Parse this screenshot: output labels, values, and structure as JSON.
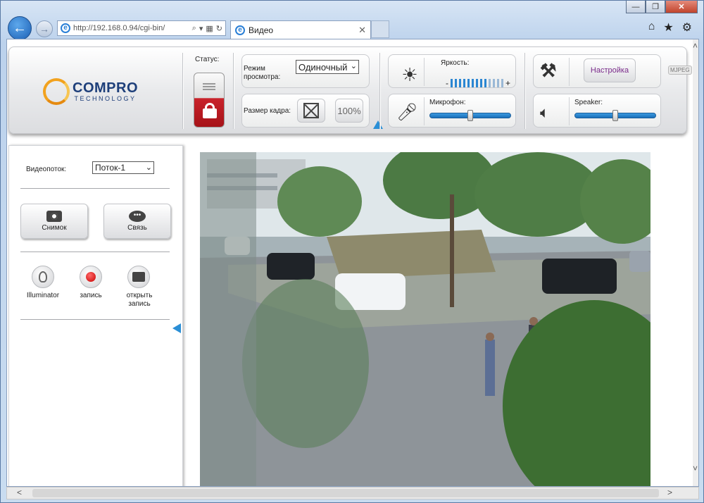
{
  "browser": {
    "url": "http://192.168.0.94/cgi-bin/",
    "tab_title": "Видео",
    "tab_close": "✕",
    "win_minimize": "—",
    "win_maximize": "❐",
    "win_close": "✕"
  },
  "logo": {
    "name": "COMPRO",
    "subtitle": "TECHNOLOGY"
  },
  "status": {
    "label": "Статус:"
  },
  "view_mode": {
    "label": "Режим просмотра:",
    "selected": "Одиночный"
  },
  "frame_size": {
    "label": "Размер кадра:",
    "percent_label": "100%"
  },
  "brightness": {
    "label": "Яркость:",
    "minus": "-",
    "plus": "+",
    "level_fraction": 0.7
  },
  "microphone": {
    "label": "Микрофон:",
    "level_fraction": 0.5
  },
  "speaker": {
    "label": "Speaker:",
    "level_fraction": 0.5
  },
  "settings": {
    "label": "Настройка",
    "codec_badge": "MJPEG"
  },
  "left_panel": {
    "stream_label": "Видеопоток:",
    "stream_selected": "Поток-1",
    "snapshot_label": "Снимок",
    "talk_label": "Связь",
    "illuminator_label": "Illuminator",
    "record_label": "запись",
    "open_record_label": "открыть запись"
  },
  "icons": {
    "back": "arrow-left-icon",
    "forward": "arrow-right-icon",
    "home": "home-icon",
    "favorites": "star-icon",
    "tools": "gear-icon"
  },
  "colors": {
    "accent": "#2b8fd6",
    "lock_red": "#c9232b",
    "brand_blue": "#1e3f7a",
    "brand_orange": "#f2a21e"
  }
}
